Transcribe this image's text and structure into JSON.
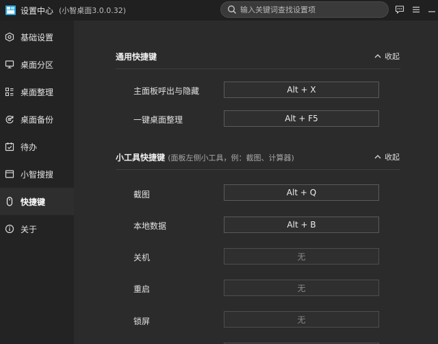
{
  "window": {
    "title": "设置中心",
    "version": "(小智桌面3.0.0.32)"
  },
  "search": {
    "placeholder": "输入关键词查找设置项"
  },
  "titlebar_icons": [
    "feedback-icon",
    "menu-icon",
    "minimize-icon"
  ],
  "sidebar": {
    "items": [
      {
        "label": "基础设置",
        "icon": "hexagon-settings-icon"
      },
      {
        "label": "桌面分区",
        "icon": "monitor-icon"
      },
      {
        "label": "桌面整理",
        "icon": "organize-icon"
      },
      {
        "label": "桌面备份",
        "icon": "backup-icon"
      },
      {
        "label": "待办",
        "icon": "calendar-check-icon"
      },
      {
        "label": "小智搜搜",
        "icon": "search-window-icon"
      },
      {
        "label": "快捷键",
        "icon": "mouse-icon"
      },
      {
        "label": "关于",
        "icon": "info-icon"
      }
    ],
    "active_index": 6
  },
  "sections": [
    {
      "title": "通用快捷键",
      "note": "",
      "collapse_label": "收起",
      "rows": [
        {
          "label": "主面板呼出与隐藏",
          "value": "Alt + X"
        },
        {
          "label": "一键桌面整理",
          "value": "Alt + F5"
        }
      ]
    },
    {
      "title": "小工具快捷键",
      "note": "(面板左侧小工具，例：截图、计算器)",
      "collapse_label": "收起",
      "rows": [
        {
          "label": "截图",
          "value": "Alt + Q"
        },
        {
          "label": "本地数据",
          "value": "Alt + B"
        },
        {
          "label": "关机",
          "value": "无"
        },
        {
          "label": "重启",
          "value": "无"
        },
        {
          "label": "锁屏",
          "value": "无"
        }
      ]
    }
  ],
  "colors": {
    "accent_logo": "#2aa7e0",
    "sidebar_bg": "#232323",
    "main_bg": "#2b2b2b"
  }
}
